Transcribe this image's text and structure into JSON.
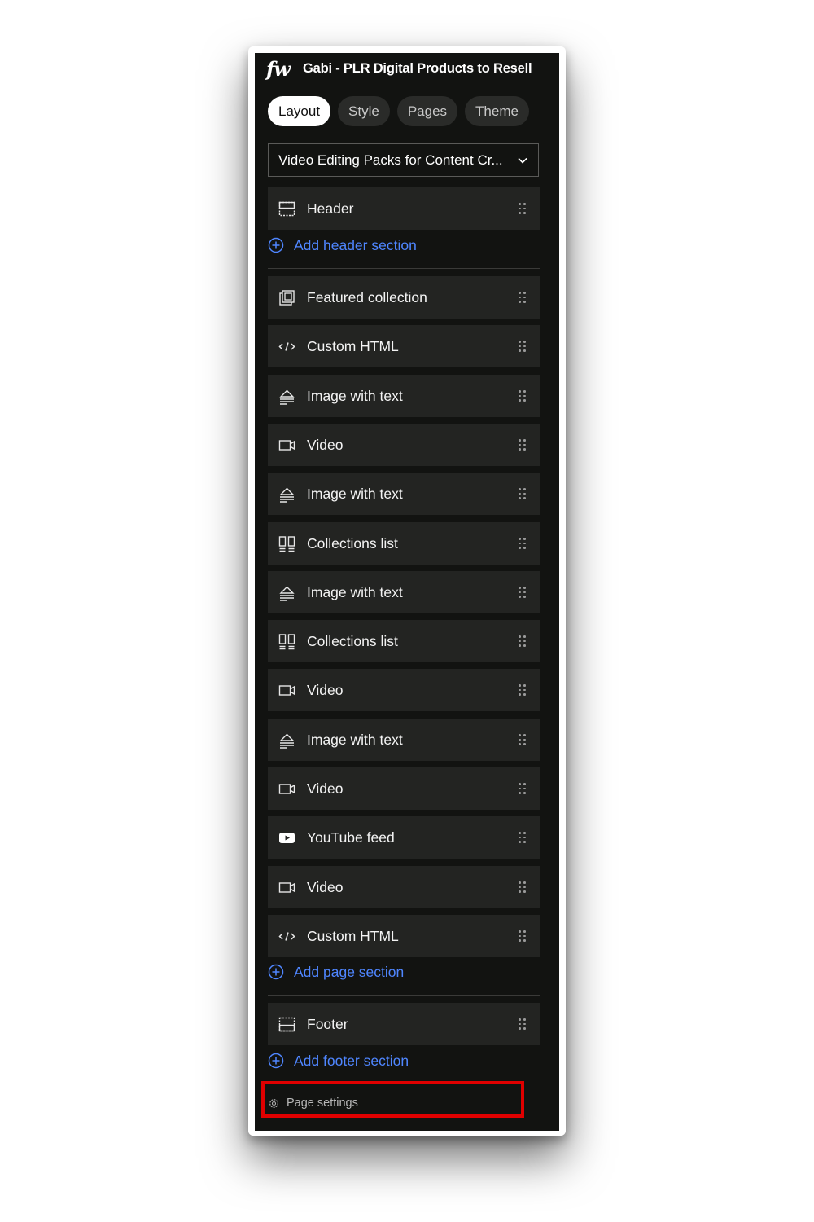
{
  "app": {
    "logo": "fw",
    "site_title": "Gabi - PLR Digital Products to Resell"
  },
  "tabs": [
    {
      "label": "Layout",
      "active": true
    },
    {
      "label": "Style",
      "active": false
    },
    {
      "label": "Pages",
      "active": false
    },
    {
      "label": "Theme",
      "active": false
    }
  ],
  "page_select": {
    "value": "Video Editing Packs for Content Cr...",
    "icon": "chevron-down-icon"
  },
  "header_section": {
    "label": "Header",
    "icon": "header-layout-icon"
  },
  "add_header": {
    "label": "Add header section",
    "icon": "plus-circle-icon"
  },
  "sections": [
    {
      "label": "Featured collection",
      "icon": "featured-collection-icon"
    },
    {
      "label": "Custom HTML",
      "icon": "code-icon"
    },
    {
      "label": "Image with text",
      "icon": "image-with-text-icon"
    },
    {
      "label": "Video",
      "icon": "video-camera-icon"
    },
    {
      "label": "Image with text",
      "icon": "image-with-text-icon"
    },
    {
      "label": "Collections list",
      "icon": "collections-list-icon"
    },
    {
      "label": "Image with text",
      "icon": "image-with-text-icon"
    },
    {
      "label": "Collections list",
      "icon": "collections-list-icon"
    },
    {
      "label": "Video",
      "icon": "video-camera-icon"
    },
    {
      "label": "Image with text",
      "icon": "image-with-text-icon"
    },
    {
      "label": "Video",
      "icon": "video-camera-icon"
    },
    {
      "label": "YouTube feed",
      "icon": "youtube-icon"
    },
    {
      "label": "Video",
      "icon": "video-camera-icon"
    },
    {
      "label": "Custom HTML",
      "icon": "code-icon"
    }
  ],
  "add_page": {
    "label": "Add page section",
    "icon": "plus-circle-icon"
  },
  "footer_section": {
    "label": "Footer",
    "icon": "footer-layout-icon"
  },
  "add_footer": {
    "label": "Add footer section",
    "icon": "plus-circle-icon"
  },
  "page_settings": {
    "label": "Page settings",
    "icon": "gear-icon"
  },
  "colors": {
    "panel_bg": "#121311",
    "row_bg": "#232422",
    "accent_blue": "#4f86ff",
    "highlight_red": "#e00000"
  }
}
